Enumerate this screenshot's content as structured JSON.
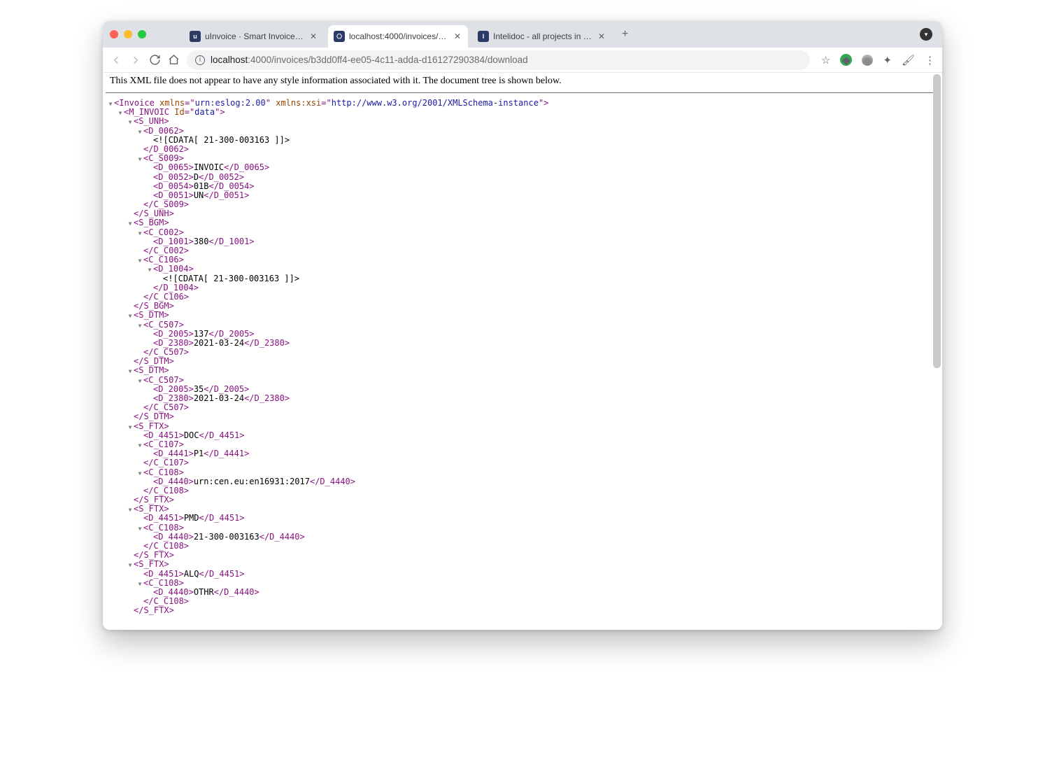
{
  "tabs": [
    {
      "title": "uInvoice · Smart Invoice Proces"
    },
    {
      "title": "localhost:4000/invoices/b3dd0"
    },
    {
      "title": "Intelidoc - all projects in one pl"
    }
  ],
  "activeTab": 1,
  "address": {
    "host": "localhost",
    "path": ":4000/invoices/b3dd0ff4-ee05-4c11-adda-d16127290384/download"
  },
  "notice": "This XML file does not appear to have any style information associated with it. The document tree is shown below.",
  "xml": {
    "root": {
      "tag": "Invoice",
      "attrs": [
        [
          "xmlns",
          "urn:eslog:2.00"
        ],
        [
          "xmlns:xsi",
          "http://www.w3.org/2001/XMLSchema-instance"
        ]
      ]
    },
    "m_invoic_id": "data",
    "cdata_entry": "21-300-003163",
    "c_s009": {
      "d0065": "INVOIC",
      "d0052": "D",
      "d0054": "01B",
      "d0051": "UN"
    },
    "c_c002_d1001": "380",
    "c_c106_d1004_cdata": "21-300-003163",
    "s_dtm1": {
      "d2005": "137",
      "d2380": "2021-03-24"
    },
    "s_dtm2": {
      "d2005": "35",
      "d2380": "2021-03-24"
    },
    "s_ftx1": {
      "d4451": "DOC",
      "c107_d4441": "P1",
      "c108_d4440": "urn:cen.eu:en16931:2017"
    },
    "s_ftx2": {
      "d4451": "PMD",
      "c108_d4440": "21-300-003163"
    },
    "s_ftx3": {
      "d4451": "ALQ",
      "c108_d4440": "OTHR"
    }
  }
}
